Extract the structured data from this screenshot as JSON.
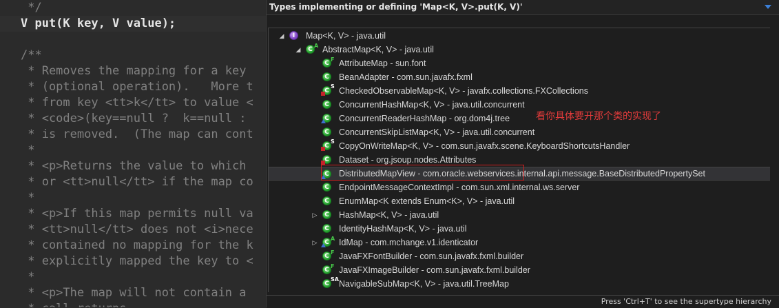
{
  "editor": {
    "lines": [
      " */",
      "V put(K key, V value);",
      "",
      "/**",
      " * Removes the mapping for a key",
      " * (optional operation).   More t",
      " * from key <tt>k</tt> to value <",
      " * <code>(key==null ?  k==null :",
      " * is removed.  (The map can cont",
      " *",
      " * <p>Returns the value to which",
      " * or <tt>null</tt> if the map co",
      " *",
      " * <p>If this map permits null va",
      " * <tt>null</tt> does not <i>nece",
      " * contained no mapping for the k",
      " * explicitly mapped the key to <",
      " *",
      " * <p>The map will not contain a",
      " * call returns."
    ]
  },
  "popup": {
    "title": "Types implementing or defining 'Map<K, V>.put(K, V)'",
    "footer": "Press 'Ctrl+T' to see the supertype hierarchy",
    "annotation": "看你具体要开那个类的实现了",
    "rows": [
      {
        "name": "Map<K, V>",
        "pkg": " - java.util",
        "kind": "interface",
        "level": 0,
        "expanded": true
      },
      {
        "name": "AbstractMap<K, V>",
        "pkg": " - java.util",
        "kind": "class",
        "overlay": "A",
        "level": 1,
        "expanded": true
      },
      {
        "name": "AttributeMap",
        "pkg": " - sun.font",
        "kind": "class",
        "overlay": "F",
        "level": 2
      },
      {
        "name": "BeanAdapter",
        "pkg": " - com.sun.javafx.fxml",
        "kind": "class",
        "level": 2
      },
      {
        "name": "CheckedObservableMap<K, V>",
        "pkg": " - javafx.collections.FXCollections",
        "kind": "class",
        "overlay": "S",
        "marker": "red",
        "level": 2
      },
      {
        "name": "ConcurrentHashMap<K, V>",
        "pkg": " - java.util.concurrent",
        "kind": "class",
        "level": 2
      },
      {
        "name": "ConcurrentReaderHashMap",
        "pkg": " - org.dom4j.tree",
        "kind": "class",
        "marker": "blue",
        "level": 2
      },
      {
        "name": "ConcurrentSkipListMap<K, V>",
        "pkg": " - java.util.concurrent",
        "kind": "class",
        "level": 2
      },
      {
        "name": "CopyOnWriteMap<K, V>",
        "pkg": " - com.sun.javafx.scene.KeyboardShortcutsHandler",
        "kind": "class",
        "overlay": "S",
        "marker": "red",
        "level": 2
      },
      {
        "name": "Dataset",
        "pkg": " - org.jsoup.nodes.Attributes",
        "kind": "class",
        "marker": "red",
        "level": 2
      },
      {
        "name": "DistributedMapView",
        "pkg": " - com.oracle.webservices.internal.api.message.BaseDistributedPropertySet",
        "kind": "class",
        "marker": "blue",
        "level": 2,
        "selected": true
      },
      {
        "name": "EndpointMessageContextImpl",
        "pkg": " - com.sun.xml.internal.ws.server",
        "kind": "class",
        "level": 2
      },
      {
        "name": "EnumMap<K extends Enum<K>, V>",
        "pkg": " - java.util",
        "kind": "class",
        "level": 2
      },
      {
        "name": "HashMap<K, V>",
        "pkg": " - java.util",
        "kind": "class",
        "level": 2,
        "collapsed": true
      },
      {
        "name": "IdentityHashMap<K, V>",
        "pkg": " - java.util",
        "kind": "class",
        "level": 2
      },
      {
        "name": "IdMap",
        "pkg": " - com.mchange.v1.identicator",
        "kind": "class",
        "overlay": "A",
        "marker": "blue",
        "level": 2,
        "collapsed": true
      },
      {
        "name": "JavaFXFontBuilder",
        "pkg": " - com.sun.javafx.fxml.builder",
        "kind": "class",
        "overlay": "F",
        "level": 2
      },
      {
        "name": "JavaFXImageBuilder",
        "pkg": " - com.sun.javafx.fxml.builder",
        "kind": "class",
        "overlay": "F",
        "level": 2
      },
      {
        "name": "NavigableSubMap<K, V>",
        "pkg": " - java.util.TreeMap",
        "kind": "class",
        "overlay": "SA",
        "level": 2
      }
    ]
  },
  "colors": {
    "editor_bg": "#2b2b2b",
    "popup_bg": "#1e1e1e",
    "class_icon": "#1f9a2a",
    "interface_icon": "#7a3fc0",
    "annotation": "#e23b3b",
    "highlight_border": "#d02020"
  }
}
